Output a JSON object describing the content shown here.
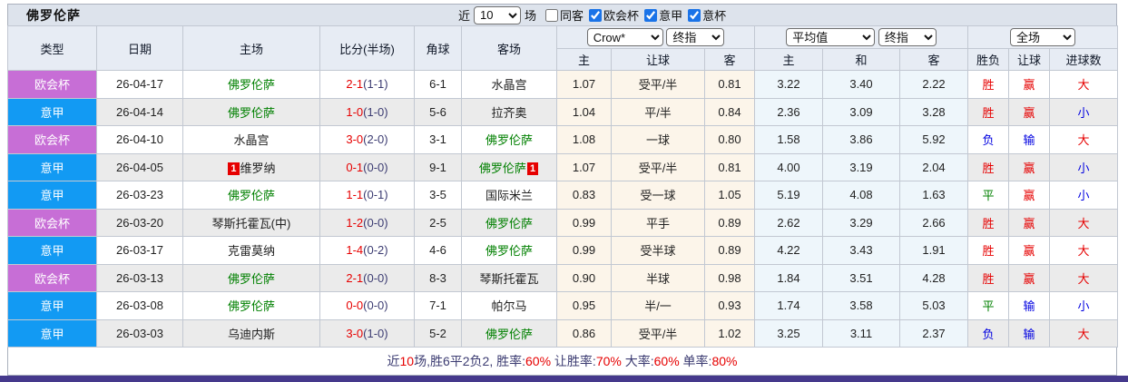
{
  "colors": {
    "accent_red": "#e60000",
    "draw_green": "#008000",
    "loss_blue": "#0000e0",
    "league_cup_purple": "#c76ed6",
    "league_serie_blue": "#129af3",
    "focus_team_green": "#008000",
    "odds_col_bg": "#fcf5ea",
    "avg_col_bg": "#eef6fb",
    "bottom_bar_purple": "#45398c"
  },
  "title_bar": {
    "team": "佛罗伦萨",
    "near_label": "近",
    "count_value": "10",
    "unit_label": "场",
    "filters": [
      {
        "label": "同客",
        "checked": false
      },
      {
        "label": "欧会杯",
        "checked": true
      },
      {
        "label": "意甲",
        "checked": true
      },
      {
        "label": "意杯",
        "checked": true
      }
    ]
  },
  "table": {
    "left_headers": [
      "类型",
      "日期",
      "主场",
      "比分(半场)",
      "角球",
      "客场"
    ],
    "group_selects": {
      "book": "Crow*",
      "book_final": "终指",
      "avg": "平均值",
      "avg_final": "终指",
      "scope": "全场"
    },
    "sub_headers": [
      "主",
      "让球",
      "客",
      "主",
      "和",
      "客",
      "胜负",
      "让球",
      "进球数"
    ],
    "rows": [
      {
        "league": "欧会杯",
        "league_type": "cup",
        "date": "26-04-17",
        "home": "佛罗伦萨",
        "home_is_focus": true,
        "home_badge": null,
        "score": "2-1",
        "half": "(1-1)",
        "corner": "6-1",
        "away": "水晶宫",
        "away_is_focus": false,
        "away_badge": null,
        "odds": [
          "1.07",
          "受平/半",
          "0.81"
        ],
        "avg": [
          "3.22",
          "3.40",
          "2.22"
        ],
        "results": [
          {
            "t": "胜",
            "c": "red"
          },
          {
            "t": "赢",
            "c": "red"
          },
          {
            "t": "大",
            "c": "red"
          }
        ]
      },
      {
        "league": "意甲",
        "league_type": "serie",
        "date": "26-04-14",
        "home": "佛罗伦萨",
        "home_is_focus": true,
        "home_badge": null,
        "score": "1-0",
        "half": "(1-0)",
        "corner": "5-6",
        "away": "拉齐奥",
        "away_is_focus": false,
        "away_badge": null,
        "odds": [
          "1.04",
          "平/半",
          "0.84"
        ],
        "avg": [
          "2.36",
          "3.09",
          "3.28"
        ],
        "results": [
          {
            "t": "胜",
            "c": "red"
          },
          {
            "t": "赢",
            "c": "red"
          },
          {
            "t": "小",
            "c": "blue"
          }
        ]
      },
      {
        "league": "欧会杯",
        "league_type": "cup",
        "date": "26-04-10",
        "home": "水晶宫",
        "home_is_focus": false,
        "home_badge": null,
        "score": "3-0",
        "half": "(2-0)",
        "corner": "3-1",
        "away": "佛罗伦萨",
        "away_is_focus": true,
        "away_badge": null,
        "odds": [
          "1.08",
          "一球",
          "0.80"
        ],
        "avg": [
          "1.58",
          "3.86",
          "5.92"
        ],
        "results": [
          {
            "t": "负",
            "c": "blue"
          },
          {
            "t": "输",
            "c": "blue"
          },
          {
            "t": "大",
            "c": "red"
          }
        ]
      },
      {
        "league": "意甲",
        "league_type": "serie",
        "date": "26-04-05",
        "home": "维罗纳",
        "home_is_focus": false,
        "home_badge": "1",
        "score": "0-1",
        "half": "(0-0)",
        "corner": "9-1",
        "away": "佛罗伦萨",
        "away_is_focus": true,
        "away_badge": "1",
        "odds": [
          "1.07",
          "受平/半",
          "0.81"
        ],
        "avg": [
          "4.00",
          "3.19",
          "2.04"
        ],
        "results": [
          {
            "t": "胜",
            "c": "red"
          },
          {
            "t": "赢",
            "c": "red"
          },
          {
            "t": "小",
            "c": "blue"
          }
        ]
      },
      {
        "league": "意甲",
        "league_type": "serie",
        "date": "26-03-23",
        "home": "佛罗伦萨",
        "home_is_focus": true,
        "home_badge": null,
        "score": "1-1",
        "half": "(0-1)",
        "corner": "3-5",
        "away": "国际米兰",
        "away_is_focus": false,
        "away_badge": null,
        "odds": [
          "0.83",
          "受一球",
          "1.05"
        ],
        "avg": [
          "5.19",
          "4.08",
          "1.63"
        ],
        "results": [
          {
            "t": "平",
            "c": "green"
          },
          {
            "t": "赢",
            "c": "red"
          },
          {
            "t": "小",
            "c": "blue"
          }
        ]
      },
      {
        "league": "欧会杯",
        "league_type": "cup",
        "date": "26-03-20",
        "home": "琴斯托霍瓦(中)",
        "home_is_focus": false,
        "home_badge": null,
        "score": "1-2",
        "half": "(0-0)",
        "corner": "2-5",
        "away": "佛罗伦萨",
        "away_is_focus": true,
        "away_badge": null,
        "odds": [
          "0.99",
          "平手",
          "0.89"
        ],
        "avg": [
          "2.62",
          "3.29",
          "2.66"
        ],
        "results": [
          {
            "t": "胜",
            "c": "red"
          },
          {
            "t": "赢",
            "c": "red"
          },
          {
            "t": "大",
            "c": "red"
          }
        ]
      },
      {
        "league": "意甲",
        "league_type": "serie",
        "date": "26-03-17",
        "home": "克雷莫纳",
        "home_is_focus": false,
        "home_badge": null,
        "score": "1-4",
        "half": "(0-2)",
        "corner": "4-6",
        "away": "佛罗伦萨",
        "away_is_focus": true,
        "away_badge": null,
        "odds": [
          "0.99",
          "受半球",
          "0.89"
        ],
        "avg": [
          "4.22",
          "3.43",
          "1.91"
        ],
        "results": [
          {
            "t": "胜",
            "c": "red"
          },
          {
            "t": "赢",
            "c": "red"
          },
          {
            "t": "大",
            "c": "red"
          }
        ]
      },
      {
        "league": "欧会杯",
        "league_type": "cup",
        "date": "26-03-13",
        "home": "佛罗伦萨",
        "home_is_focus": true,
        "home_badge": null,
        "score": "2-1",
        "half": "(0-0)",
        "corner": "8-3",
        "away": "琴斯托霍瓦",
        "away_is_focus": false,
        "away_badge": null,
        "odds": [
          "0.90",
          "半球",
          "0.98"
        ],
        "avg": [
          "1.84",
          "3.51",
          "4.28"
        ],
        "results": [
          {
            "t": "胜",
            "c": "red"
          },
          {
            "t": "赢",
            "c": "red"
          },
          {
            "t": "大",
            "c": "red"
          }
        ]
      },
      {
        "league": "意甲",
        "league_type": "serie",
        "date": "26-03-08",
        "home": "佛罗伦萨",
        "home_is_focus": true,
        "home_badge": null,
        "score": "0-0",
        "half": "(0-0)",
        "corner": "7-1",
        "away": "帕尔马",
        "away_is_focus": false,
        "away_badge": null,
        "odds": [
          "0.95",
          "半/一",
          "0.93"
        ],
        "avg": [
          "1.74",
          "3.58",
          "5.03"
        ],
        "results": [
          {
            "t": "平",
            "c": "green"
          },
          {
            "t": "输",
            "c": "blue"
          },
          {
            "t": "小",
            "c": "blue"
          }
        ]
      },
      {
        "league": "意甲",
        "league_type": "serie",
        "date": "26-03-03",
        "home": "乌迪内斯",
        "home_is_focus": false,
        "home_badge": null,
        "score": "3-0",
        "half": "(1-0)",
        "corner": "5-2",
        "away": "佛罗伦萨",
        "away_is_focus": true,
        "away_badge": null,
        "odds": [
          "0.86",
          "受平/半",
          "1.02"
        ],
        "avg": [
          "3.25",
          "3.11",
          "2.37"
        ],
        "results": [
          {
            "t": "负",
            "c": "blue"
          },
          {
            "t": "输",
            "c": "blue"
          },
          {
            "t": "大",
            "c": "red"
          }
        ]
      }
    ]
  },
  "footer": {
    "parts": [
      {
        "t": "近",
        "c": "dark"
      },
      {
        "t": "10",
        "c": "red"
      },
      {
        "t": "场,胜6平2负2, 胜率:",
        "c": "dark"
      },
      {
        "t": "60%",
        "c": "red"
      },
      {
        "t": " 让胜率:",
        "c": "dark"
      },
      {
        "t": "70%",
        "c": "red"
      },
      {
        "t": " 大率:",
        "c": "dark"
      },
      {
        "t": "60%",
        "c": "red"
      },
      {
        "t": " 单率:",
        "c": "dark"
      },
      {
        "t": "80%",
        "c": "red"
      }
    ]
  }
}
